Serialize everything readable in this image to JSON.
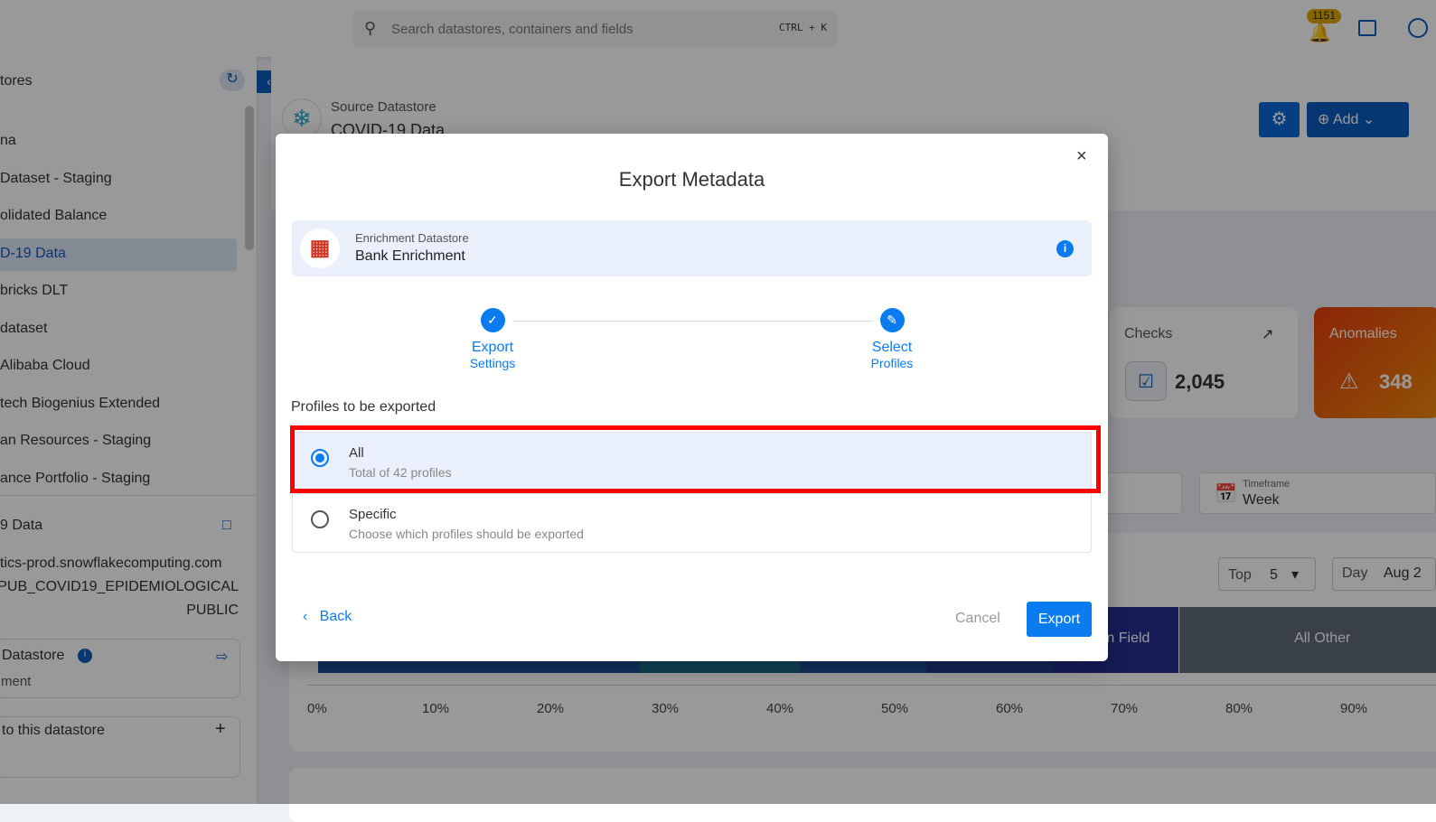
{
  "topbar": {
    "search_placeholder": "Search datastores, containers and fields",
    "shortcut": "CTRL + K",
    "notification_count": "1151"
  },
  "sidebar": {
    "header": "tores",
    "items": [
      "na",
      "Dataset - Staging",
      "olidated Balance",
      "D-19 Data",
      "bricks DLT",
      "dataset",
      "Alibaba Cloud",
      "tech Biogenius Extended",
      "an Resources - Staging",
      "ance Portfolio - Staging"
    ],
    "active_index": 3,
    "detail": {
      "name": "9 Data",
      "host": "tics-prod.snowflakecomputing.com",
      "database": "PUB_COVID19_EPIDEMIOLOGICAL",
      "schema": "PUBLIC",
      "enrichment_label": "Datastore",
      "enrichment_value": "ment",
      "link_label": "to this datastore"
    }
  },
  "header": {
    "source_label": "Source Datastore",
    "source_name": "COVID-19 Data",
    "add_label": "Add"
  },
  "stats": {
    "checks_label": "Checks",
    "checks_value": "2,045",
    "anomalies_label": "Anomalies",
    "anomalies_value": "348"
  },
  "filters": {
    "timeframe_label": "Timeframe",
    "timeframe_value": "Week",
    "top_label": "Top",
    "top_value": "5",
    "day_label": "Day",
    "date_value": "Aug 2"
  },
  "chart_data": {
    "type": "bar",
    "orientation": "horizontal-stacked",
    "segments": [
      {
        "from": 0,
        "to": 28,
        "color": "#1f4f9a"
      },
      {
        "from": 28,
        "to": 42,
        "color": "#1a6b8a"
      },
      {
        "from": 42,
        "to": 53,
        "color": "#1f4f9a"
      },
      {
        "from": 53,
        "to": 64,
        "color": "#1e3a8a"
      },
      {
        "from": 64,
        "to": 75,
        "color": "#23308f",
        "label": "Than Field"
      },
      {
        "from": 75,
        "to": 100,
        "color": "#5f6b7a",
        "label": "All Other"
      }
    ],
    "ticks": [
      "0%",
      "10%",
      "20%",
      "30%",
      "40%",
      "50%",
      "60%",
      "70%",
      "80%",
      "90%"
    ],
    "xlim": [
      0,
      100
    ]
  },
  "modal": {
    "title": "Export Metadata",
    "enrichment_label": "Enrichment Datastore",
    "enrichment_name": "Bank Enrichment",
    "steps": [
      {
        "line1": "Export",
        "line2": "Settings",
        "state": "done"
      },
      {
        "line1": "Select",
        "line2": "Profiles",
        "state": "active"
      }
    ],
    "section_label": "Profiles to be exported",
    "options": [
      {
        "title": "All",
        "subtitle": "Total of 42 profiles",
        "selected": true
      },
      {
        "title": "Specific",
        "subtitle": "Choose which profiles should be exported",
        "selected": false
      }
    ],
    "back_label": "Back",
    "cancel_label": "Cancel",
    "export_label": "Export"
  },
  "colors": {
    "accent": "#0b7cf0",
    "highlight": "#ff0000",
    "anomalies": "#e8590c"
  }
}
